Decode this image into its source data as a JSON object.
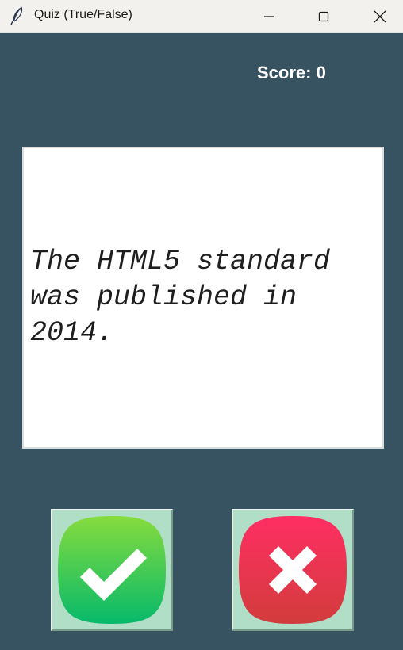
{
  "window": {
    "title": "Quiz (True/False)",
    "icons": {
      "app": "feather-icon",
      "minimize": "minimize-icon",
      "maximize": "maximize-icon",
      "close": "close-icon"
    }
  },
  "quiz": {
    "score_text": "Score: 0",
    "question_text": "The HTML5 standard was published in 2014.",
    "true_button_icon": "checkmark-icon",
    "false_button_icon": "cross-icon"
  },
  "colors": {
    "background": "#375362",
    "card": "#ffffff",
    "button_face": "#b1dec6",
    "true_gradient": [
      "#86dc3d",
      "#06b96b"
    ],
    "false_gradient": [
      "#ff2e63",
      "#d23c3c"
    ]
  }
}
